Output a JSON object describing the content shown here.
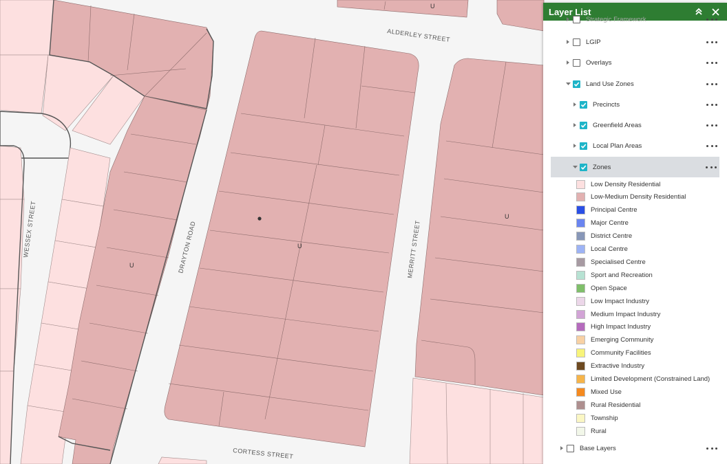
{
  "map": {
    "streets": {
      "alderley": "ALDERLEY STREET",
      "wessex": "WESSEX STREET",
      "drayton": "DRAYTON ROAD",
      "merritt": "MERRITT STREET",
      "cortess": "CORTESS STREET"
    },
    "unit_label": "U",
    "colors": {
      "low_medium_density": "#e2b1b1",
      "low_density": "#fde0e0",
      "road": "#f5f5f5"
    }
  },
  "layer_list": {
    "title": "Layer List",
    "collapse_icon": "double-chevron-up-icon",
    "close_icon": "close-icon",
    "layers": [
      {
        "label": "Strategic Framework",
        "checked": false,
        "faded": true
      },
      {
        "label": "LGIP",
        "checked": false
      },
      {
        "label": "Overlays",
        "checked": false
      },
      {
        "label": "Land Use Zones",
        "checked": true,
        "expanded": true
      },
      {
        "label": "Precincts",
        "checked": true
      },
      {
        "label": "Greenfield Areas",
        "checked": true
      },
      {
        "label": "Local Plan Areas",
        "checked": true
      },
      {
        "label": "Zones",
        "checked": true,
        "expanded": true,
        "selected": true
      }
    ],
    "legend": [
      {
        "label": "Low Density Residential",
        "color": "#fde0e0"
      },
      {
        "label": "Low-Medium Density Residential",
        "color": "#e2b1b1"
      },
      {
        "label": "Principal Centre",
        "color": "#2a4fe6"
      },
      {
        "label": "Major Centre",
        "color": "#6a85f0"
      },
      {
        "label": "District Centre",
        "color": "#8897b8"
      },
      {
        "label": "Local Centre",
        "color": "#9db3f5"
      },
      {
        "label": "Specialised Centre",
        "color": "#a79aa2"
      },
      {
        "label": "Sport and Recreation",
        "color": "#b7e2d3"
      },
      {
        "label": "Open Space",
        "color": "#7fbf6a"
      },
      {
        "label": "Low Impact Industry",
        "color": "#ecd7e9"
      },
      {
        "label": "Medium Impact Industry",
        "color": "#d2a4d6"
      },
      {
        "label": "High Impact Industry",
        "color": "#b56bbd"
      },
      {
        "label": "Emerging Community",
        "color": "#f8d1a4"
      },
      {
        "label": "Community Facilities",
        "color": "#f8f47a"
      },
      {
        "label": "Extractive Industry",
        "color": "#6e4a21"
      },
      {
        "label": "Limited Development (Constrained Land)",
        "color": "#f6b44a"
      },
      {
        "label": "Mixed Use",
        "color": "#f58a1f"
      },
      {
        "label": "Rural Residential",
        "color": "#ae8f8f"
      },
      {
        "label": "Township",
        "color": "#fbf7c4"
      },
      {
        "label": "Rural",
        "color": "#f2f7e9"
      }
    ],
    "base_layers": {
      "label": "Base Layers",
      "checked": false
    }
  }
}
